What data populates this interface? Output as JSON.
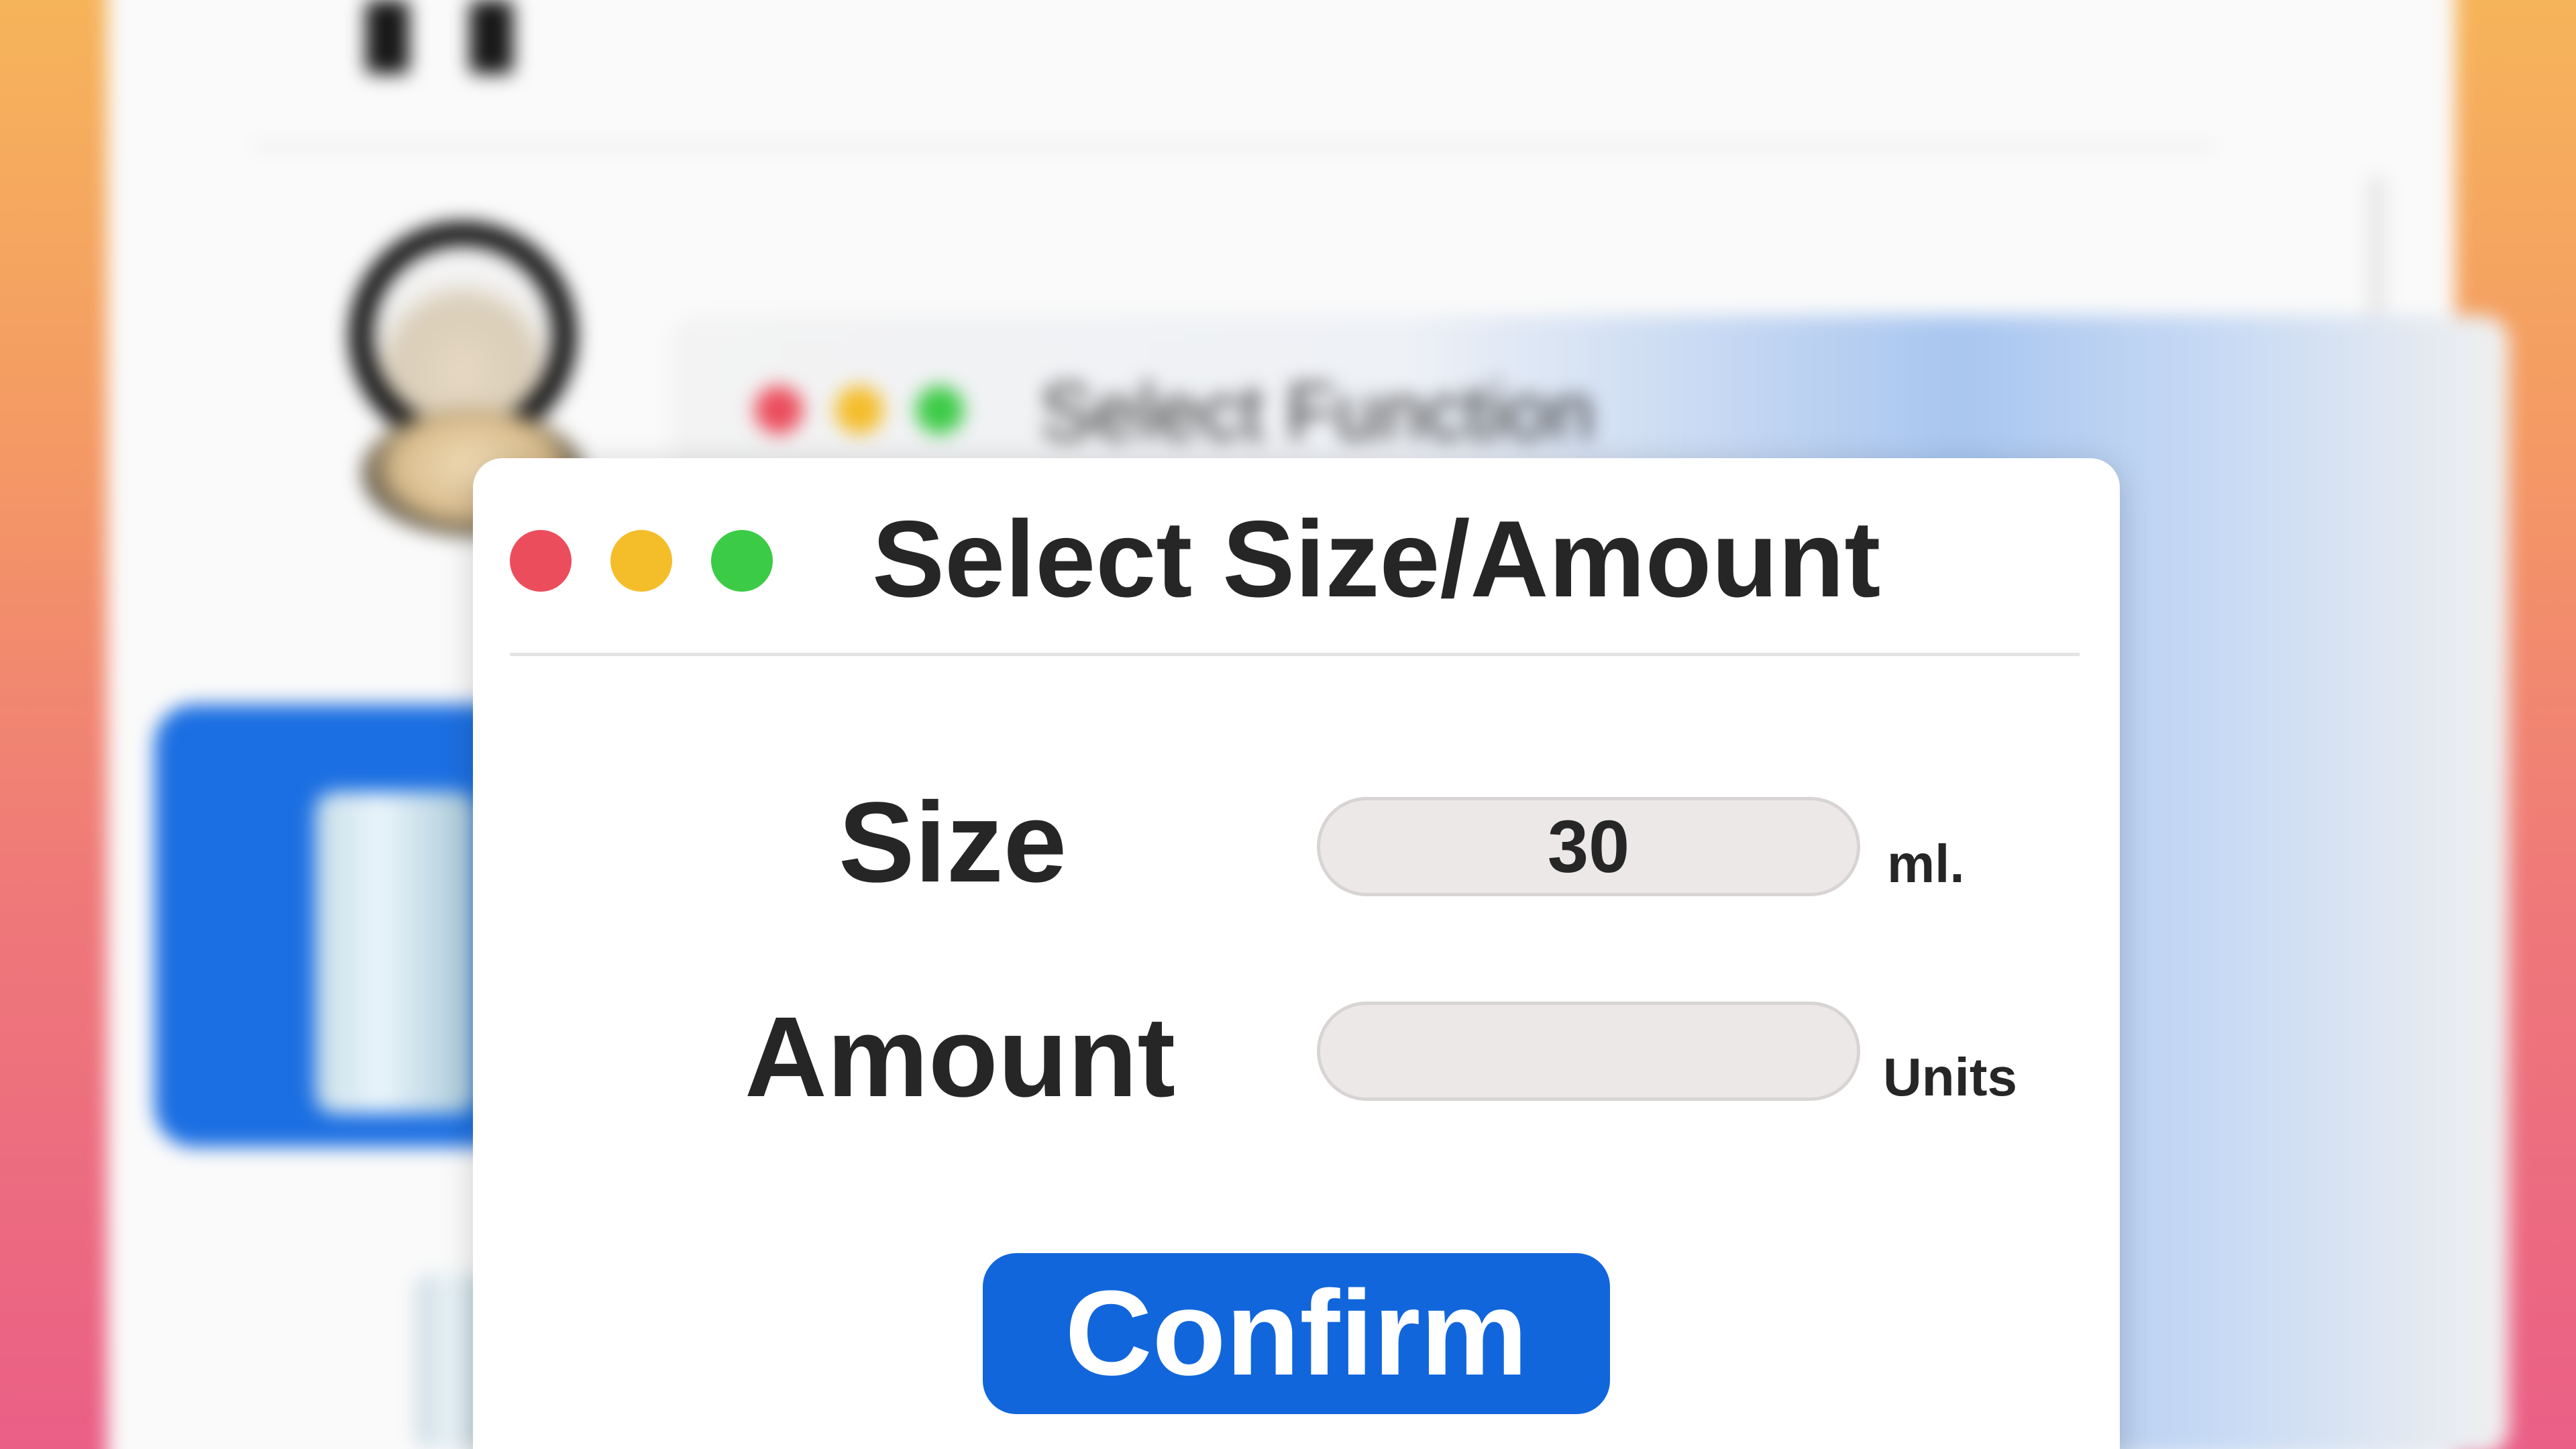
{
  "background_app": {
    "select_window_title": "Select Function"
  },
  "dialog": {
    "title": "Select Size/Amount",
    "window_controls": {
      "close": "close-control",
      "minimize": "minimize-control",
      "zoom": "zoom-control"
    },
    "fields": {
      "size": {
        "label": "Size",
        "value": "30",
        "unit": "ml."
      },
      "amount": {
        "label": "Amount",
        "value": "",
        "unit": "Units"
      }
    },
    "confirm_label": "Confirm"
  },
  "colors": {
    "accent_blue": "#1266dc",
    "traffic_close": "#ec4d5c",
    "traffic_minimize": "#f4bd2a",
    "traffic_zoom": "#3ccb46",
    "input_fill": "#ece8e8"
  }
}
